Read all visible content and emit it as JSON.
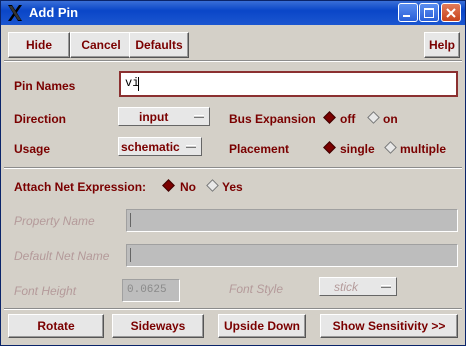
{
  "window": {
    "title": "Add Pin"
  },
  "toolbar": {
    "hide": "Hide",
    "cancel": "Cancel",
    "defaults": "Defaults",
    "help": "Help"
  },
  "pin_names": {
    "label": "Pin Names",
    "value": "vi"
  },
  "direction": {
    "label": "Direction",
    "value": "input"
  },
  "bus_expansion": {
    "label": "Bus Expansion",
    "options": [
      "off",
      "on"
    ],
    "selected": "off"
  },
  "usage": {
    "label": "Usage",
    "value": "schematic"
  },
  "placement": {
    "label": "Placement",
    "options": [
      "single",
      "multiple"
    ],
    "selected": "single"
  },
  "attach_net": {
    "label": "Attach Net Expression:",
    "options": [
      "No",
      "Yes"
    ],
    "selected": "No"
  },
  "property_name": {
    "label": "Property Name",
    "value": ""
  },
  "default_net_name": {
    "label": "Default Net Name",
    "value": ""
  },
  "font_height": {
    "label": "Font Height",
    "value": "0.0625"
  },
  "font_style": {
    "label": "Font Style",
    "value": "stick"
  },
  "bottom_buttons": {
    "rotate": "Rotate",
    "sideways": "Sideways",
    "upside_down": "Upside Down",
    "show_sensitivity": "Show Sensitivity >>"
  },
  "colors": {
    "label": "#7a0000",
    "titlebar": "#0a46c8",
    "background": "#d4d0c8"
  }
}
